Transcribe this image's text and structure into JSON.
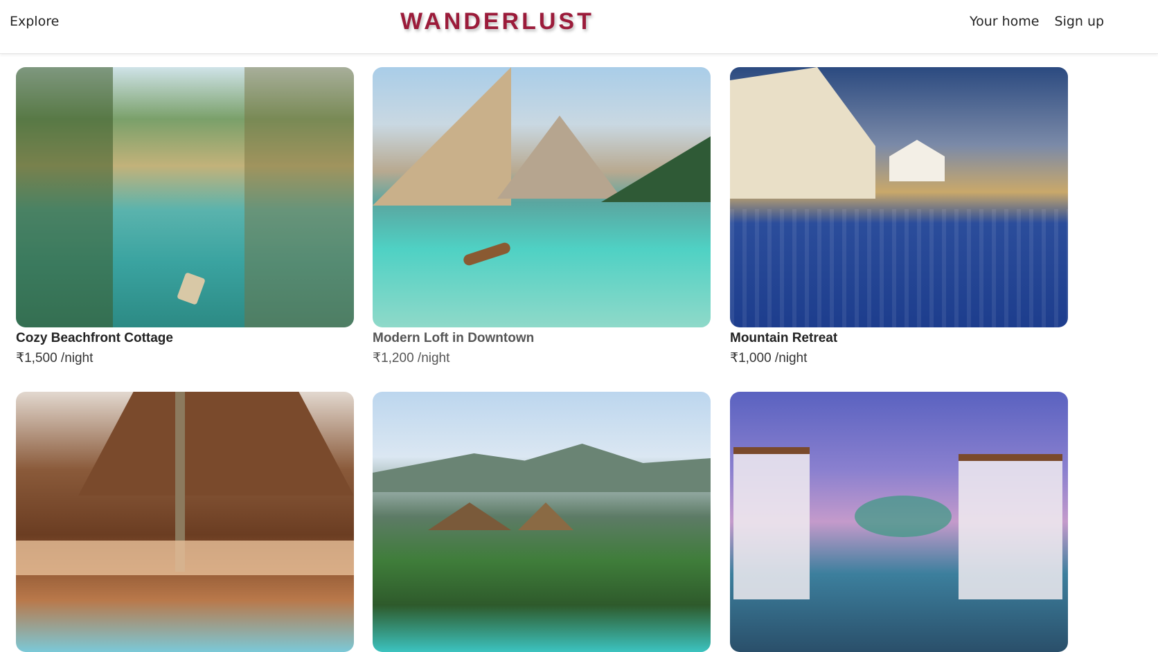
{
  "nav": {
    "explore": "Explore",
    "brand": "WANDERLUST",
    "links": [
      "Your home",
      "Sign up"
    ]
  },
  "listings": [
    {
      "title": "Cozy Beachfront Cottage",
      "price": "₹1,500 /night",
      "image": "tropical-river-palms"
    },
    {
      "title": "Modern Loft in Downtown",
      "price": "₹1,200 /night",
      "image": "mountain-lake-boat"
    },
    {
      "title": "Mountain Retreat",
      "price": "₹1,000 /night",
      "image": "resort-pool-dusk"
    },
    {
      "title": "",
      "price": "",
      "image": "wooden-lodge-pool"
    },
    {
      "title": "",
      "price": "",
      "image": "tropical-villas-pool"
    },
    {
      "title": "",
      "price": "",
      "image": "sunset-cabana-pool"
    }
  ],
  "colors": {
    "brand": "#9b1b3a",
    "text": "#222222"
  }
}
